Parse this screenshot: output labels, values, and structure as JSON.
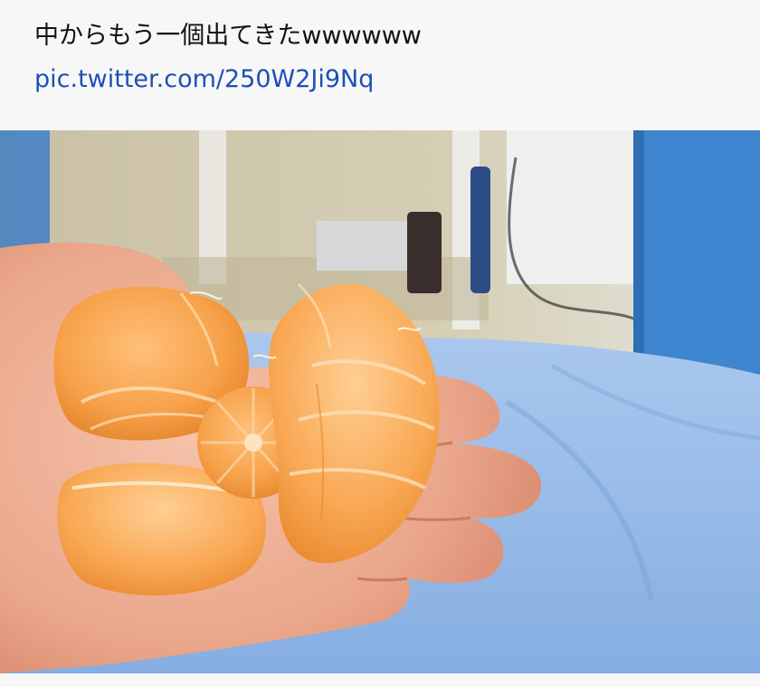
{
  "post": {
    "text": "中からもう一個出てきたwwwwww",
    "link": "pic.twitter.com/250W2Ji9Nq"
  },
  "photo": {
    "subject": "tangerine-in-hand-photo"
  },
  "colors": {
    "link": "#1e50b4",
    "text": "#111111",
    "background": "#f7f7f7",
    "orange": "#f59a3e",
    "blanket": "#9cc0e8"
  }
}
